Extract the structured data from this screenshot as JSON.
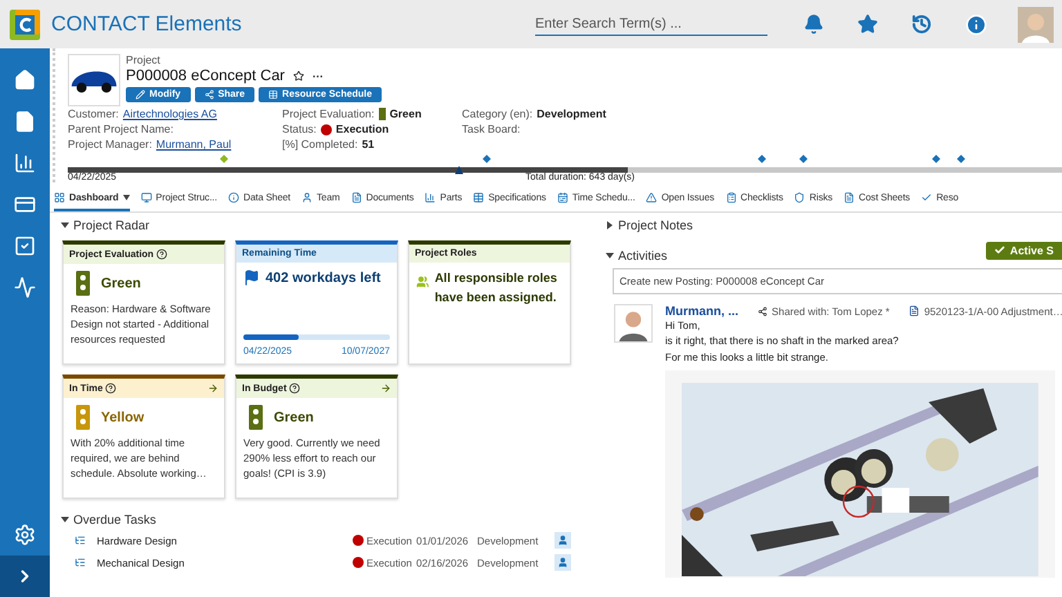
{
  "app": {
    "title": "CONTACT Elements",
    "search": {
      "placeholder": "Enter Search Term(s) ..."
    }
  },
  "project": {
    "type_label": "Project",
    "title": "P000008 eConcept Car",
    "more": "···",
    "buttons": [
      {
        "label": "Modify",
        "kind": "edit"
      },
      {
        "label": "Share",
        "kind": "share"
      },
      {
        "label": "Resource Schedule",
        "kind": "schedule"
      }
    ],
    "fields": [
      {
        "label": "Customer:",
        "value": "Airtechnologies AG",
        "kind": "link"
      },
      {
        "label": "Project Evaluation:",
        "value": "Green",
        "kind": "light",
        "color": "#5a6e12"
      },
      {
        "label": "Category (en):",
        "value": "Development",
        "kind": "text"
      },
      {
        "label": "Parent Project Name:",
        "kind": "text"
      },
      {
        "label": "Status:",
        "value": "Execution",
        "kind": "dot",
        "color": "#c00000"
      },
      {
        "label": "Task Board:",
        "kind": "text"
      },
      {
        "label": "Project Manager:",
        "value": "Murmann, Paul",
        "kind": "link"
      },
      {
        "label": "[%] Completed:",
        "value": "51",
        "kind": "text"
      }
    ],
    "timeline": {
      "start": "04/22/2025",
      "total": "Total duration: 643 day(s)",
      "level": 0.56
    }
  },
  "tabs": [
    {
      "label": "Dashboard",
      "selected": true
    },
    {
      "label": "Project Struc...",
      "selected": false
    },
    {
      "label": "Data Sheet",
      "selected": false
    },
    {
      "label": "Team",
      "selected": false
    },
    {
      "label": "Documents",
      "selected": false
    },
    {
      "label": "Parts",
      "selected": false
    },
    {
      "label": "Specifications",
      "selected": false
    },
    {
      "label": "Time Schedu...",
      "selected": false
    },
    {
      "label": "Open Issues",
      "selected": false
    },
    {
      "label": "Checklists",
      "selected": false
    },
    {
      "label": "Risks",
      "selected": false
    },
    {
      "label": "Cost Sheets",
      "selected": false
    },
    {
      "label": "Reso",
      "selected": false
    }
  ],
  "radar": {
    "title": "Project Radar",
    "expanded": true,
    "cards": [
      {
        "kind": "evaluation",
        "title": "Project Evaluation",
        "help": true,
        "arrow": false,
        "color": "#5a6e12",
        "status": "Green",
        "text": "Reason: Hardware & Software Design not started - Additional resources requested"
      },
      {
        "kind": "remaining",
        "title": "Remaining Time",
        "help": false,
        "arrow": false,
        "color": "#1565c0",
        "status": "402 workdays left",
        "level": 0.38,
        "start": "04/22/2025",
        "end": "10/07/2027"
      },
      {
        "kind": "roles",
        "title": "Project Roles",
        "help": false,
        "arrow": false,
        "color": "#9ac11c",
        "status": "All responsible roles have been assigned."
      },
      {
        "kind": "evaluation",
        "title": "In Time",
        "help": true,
        "arrow": true,
        "color": "#c8960a",
        "status": "Yellow",
        "text": "With 20% additional time required, we are behind schedule. Absolute working…"
      },
      {
        "kind": "evaluation",
        "title": "In Budget",
        "help": true,
        "arrow": true,
        "color": "#5a6e12",
        "status": "Green",
        "text": "Very good. Currently we need 290% less effort to reach our goals! (CPI is 3.9)"
      }
    ]
  },
  "overdue": {
    "title": "Overdue Tasks",
    "expanded": true,
    "rows": [
      {
        "name": "Hardware Design",
        "status": "Execution",
        "color": "#c00000",
        "date": "01/01/2026",
        "category": "Development"
      },
      {
        "name": "Mechanical Design",
        "status": "Execution",
        "color": "#c00000",
        "date": "02/16/2026",
        "category": "Development"
      }
    ]
  },
  "notes": {
    "title": "Project Notes",
    "expanded": false
  },
  "activities": {
    "title": "Activities",
    "expanded": true,
    "filter": "Active S",
    "posting": {
      "placeholder": "Create new Posting: P000008 eConcept Car"
    },
    "post": {
      "author": "Murmann, ...",
      "shared": "Shared with: Tom Lopez *",
      "attachment": "9520123-1/A-00 Adjustment…",
      "lines": [
        "Hi Tom,",
        "is it right, that there is no shaft in the marked area?",
        "For me this looks a little bit strange."
      ]
    }
  }
}
